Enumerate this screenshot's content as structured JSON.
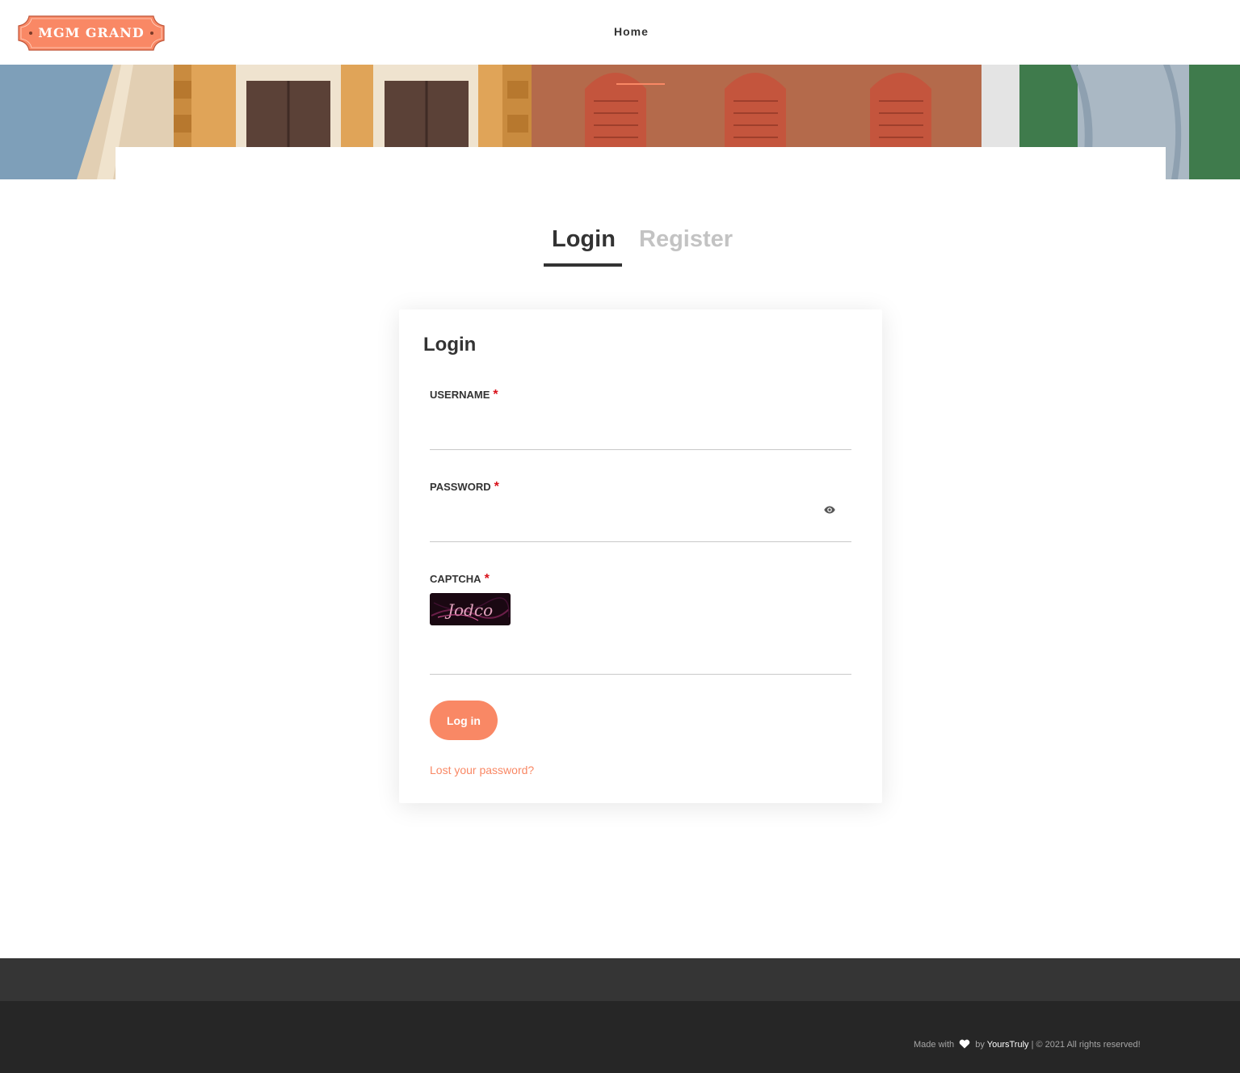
{
  "header": {
    "logo_text": "MGM GRAND",
    "nav": {
      "home": "Home"
    }
  },
  "tabs": {
    "login": "Login",
    "register": "Register",
    "active": "login"
  },
  "login_form": {
    "title": "Login",
    "username_label": "USERNAME",
    "password_label": "PASSWORD",
    "captcha_label": "CAPTCHA",
    "captcha_text": "Jodco",
    "required_marker": "*",
    "username_value": "",
    "password_value": "",
    "captcha_value": "",
    "submit_label": "Log in",
    "lost_password_label": "Lost your password?"
  },
  "footer": {
    "made_with": "Made with",
    "by": "by",
    "brand": "YoursTruly",
    "copyright": "| © 2021 All rights reserved!"
  },
  "colors": {
    "accent": "#f98865",
    "footer_top": "#353535",
    "footer_bottom": "#262626"
  },
  "icons": [
    "eye-icon",
    "heart-icon"
  ]
}
